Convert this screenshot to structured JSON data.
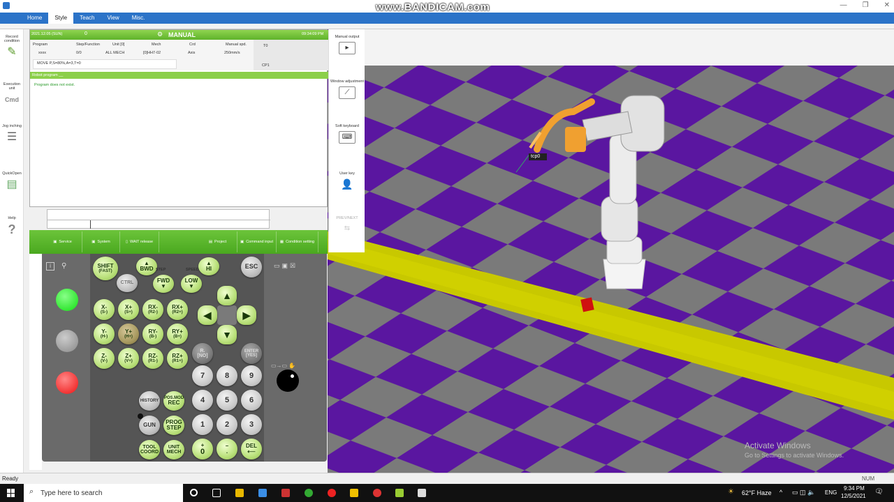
{
  "watermark": "www.BANDICAM.com",
  "ribbon": {
    "tabs": [
      "Home",
      "Style",
      "Teach",
      "View",
      "Misc."
    ],
    "active": "Style"
  },
  "leftbar": [
    "Record condition",
    "Execution unit",
    "Jog inching",
    "QuickOpen",
    "Help"
  ],
  "tp": {
    "date": "2021.12.05 (SUN)",
    "time": "09:34:09 PM",
    "zero": "0",
    "mode": "MANUAL",
    "program_label": "Program",
    "program_val": "xxxx",
    "step_label": "Step/Function",
    "step_val": "0/0",
    "unit_label": "Unit [0]",
    "unit_val": "ALL MECH",
    "mech_label": "Mech",
    "mech_val": "[0]HH7-02",
    "crd_label": "Crd",
    "crd_val": "Axis",
    "spd_label": "Manual spd.",
    "spd_val": "250mm/s",
    "move": "MOVE P,S=80%,A=3,T=0",
    "tool": "T0",
    "cp": "CP1",
    "robot_program": "Robot program __",
    "message": "Program does not exist."
  },
  "rightbar": [
    "Manual output",
    "Window adjustment",
    "Soft keyboard",
    "User key",
    "PREV/NEXT"
  ],
  "greenbar": [
    "Service",
    "System",
    "WAIT release",
    "Project",
    "Command input",
    "Condition setting"
  ],
  "keys": {
    "shift": "SHIFT",
    "shift2": "(FAST)",
    "ctrl": "CTRL",
    "bwd": "BWD",
    "step": "STEP",
    "fwd": "FWD",
    "speed": "SPEED",
    "hi": "HI",
    "low": "LOW",
    "esc": "ESC",
    "xm": "X-",
    "xm2": "(S-)",
    "xp": "X+",
    "xp2": "(S+)",
    "rxm": "RX-",
    "rxm2": "(R2-)",
    "rxp": "RX+",
    "rxp2": "(R2+)",
    "ym": "Y-",
    "ym2": "(H-)",
    "yp": "Y+",
    "yp2": "(H+)",
    "rym": "RY-",
    "rym2": "(B-)",
    "ryp": "RY+",
    "ryp2": "(B+)",
    "zm": "Z-",
    "zm2": "(V-)",
    "zp": "Z+",
    "zp2": "(V+)",
    "rzm": "RZ-",
    "rzm2": "(R1-)",
    "rzp": "RZ+",
    "rzp2": "(R1+)",
    "r": "R",
    "no": "[NO]",
    "enter": "ENTER",
    "yes": "[YES]",
    "history": "HISTORY",
    "posmod": "POS.MOD",
    "rec": "REC",
    "gun": "GUN",
    "prog": "PROG",
    "pstep": "STEP",
    "tool": "TOOL",
    "coord": "COORD",
    "unit": "UNIT",
    "mech": "MECH",
    "n7": "7",
    "n8": "8",
    "n9": "9",
    "n4": "4",
    "n5": "5",
    "n6": "6",
    "n1": "1",
    "n2": "2",
    "n3": "3",
    "plus": "+",
    "n0": "0",
    "minus": "–",
    "dot": ".",
    "del": "DEL"
  },
  "scene": {
    "tcp_label": "tcp0"
  },
  "activate1": "Activate Windows",
  "activate2": "Go to Settings to activate Windows.",
  "status": {
    "left": "Ready",
    "right": "NUM"
  },
  "taskbar": {
    "search": "Type here to search",
    "weather": "62°F Haze",
    "lang": "ENG",
    "time": "9:34 PM",
    "date": "12/5/2021",
    "notif": "2"
  }
}
